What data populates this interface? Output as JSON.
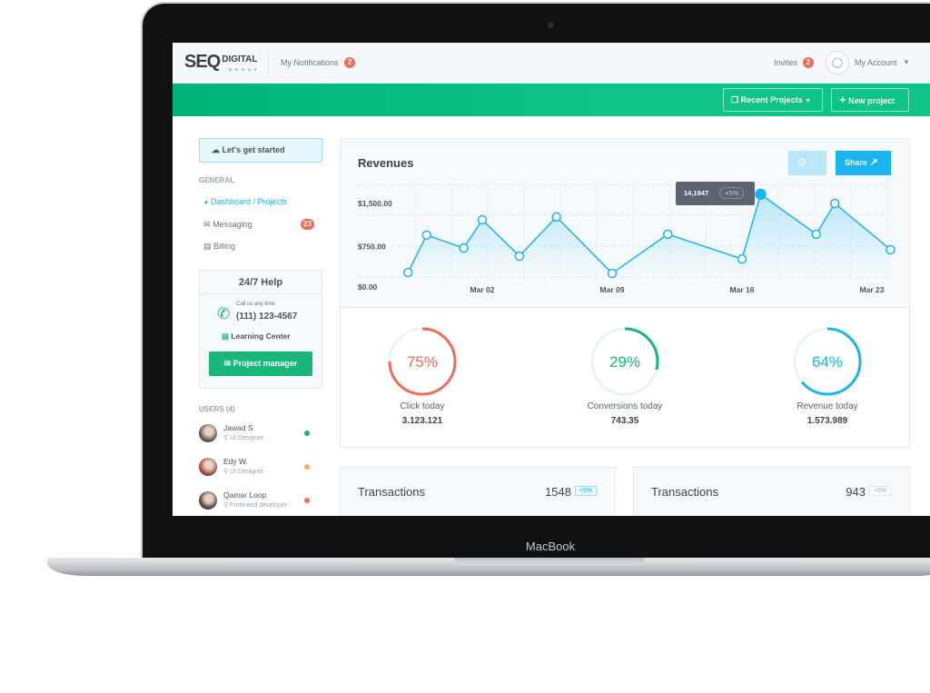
{
  "device": {
    "brand": "MacBook"
  },
  "header": {
    "logo": "SEO DIGITAL GROUP",
    "notifications_label": "My Notifications",
    "notifications_count": "2",
    "invites_label": "Invites",
    "invites_count": "2",
    "account_label": "My Account"
  },
  "toolbar": {
    "recent_projects": "Recent Projects",
    "new_project": "New project"
  },
  "sidebar": {
    "get_started": "Let's get started",
    "section": "GENERAL",
    "items": [
      {
        "label": "Dashboard / Projects",
        "icon": "dashboard-icon",
        "active": true
      },
      {
        "label": "Messaging",
        "icon": "messaging-icon",
        "badge": "23"
      },
      {
        "label": "Billing",
        "icon": "billing-icon"
      }
    ],
    "help": {
      "title": "24/7 Help",
      "call_caption": "Call us any time",
      "phone": "(111) 123-4567",
      "learning": "Learning Center",
      "pm_button": "Project manager"
    },
    "users_title": "USERS (4)",
    "users": [
      {
        "name": "Jawad S",
        "role": "UI Designer",
        "status_color": "#19b77a"
      },
      {
        "name": "Edy W.",
        "role": "UI Designer",
        "status_color": "#f7b24c"
      },
      {
        "name": "Qamar Loop",
        "role": "Front-end developer",
        "status_color": "#f26b5b"
      }
    ]
  },
  "revenues": {
    "title": "Revenues",
    "share_label": "Share",
    "tooltip": {
      "value": "14,1947",
      "change": "+5%"
    }
  },
  "chart_data": {
    "type": "area",
    "title": "Revenues",
    "y_ticks": [
      "$1,500.00",
      "$750.00",
      "$0.00"
    ],
    "x_ticks": [
      "Mar 02",
      "Mar 09",
      "Mar 16",
      "Mar 23"
    ],
    "ylim": [
      0,
      1800
    ],
    "grid": true,
    "color": "#1ab5f0",
    "x": [
      "Feb 26",
      "Feb 27",
      "Mar 01",
      "Mar 02",
      "Mar 04",
      "Mar 06",
      "Mar 09",
      "Mar 12",
      "Mar 16",
      "Mar 17",
      "Mar 20",
      "Mar 21",
      "Mar 24"
    ],
    "values": [
      300,
      950,
      725,
      1215,
      585,
      1265,
      285,
      965,
      535,
      1660,
      965,
      1500,
      695
    ],
    "highlight_index": 9
  },
  "stats": [
    {
      "percent": 75,
      "label": "Click today",
      "value": "3.123.121",
      "color": "#f26b5b"
    },
    {
      "percent": 29,
      "label": "Conversions today",
      "value": "743.35",
      "color": "#19b77a"
    },
    {
      "percent": 64,
      "label": "Revenue today",
      "value": "1.573.989",
      "color": "#1ab5f0"
    }
  ],
  "transactions": [
    {
      "title": "Transactions",
      "value": "1548",
      "change": "+5%"
    },
    {
      "title": "Transactions",
      "value": "943",
      "change": "+5%"
    }
  ]
}
